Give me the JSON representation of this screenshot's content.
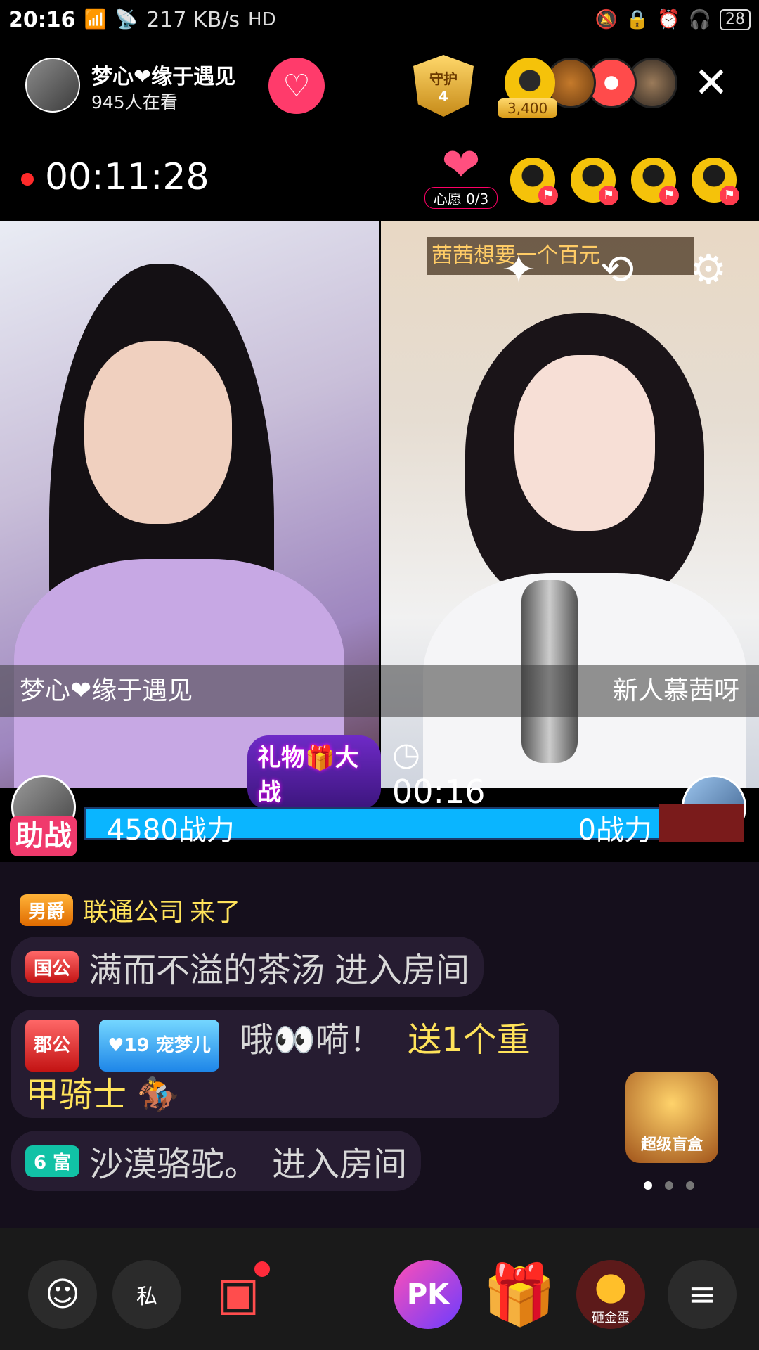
{
  "status": {
    "time": "20:16",
    "net_type": "4G",
    "speed": "217 KB/s",
    "hd": "HD",
    "battery": "28"
  },
  "header": {
    "host_name": "梦心❤缘于遇见",
    "viewers": "945人在看",
    "follow_icon": "heart-plus",
    "guard_label": "守护",
    "guard_count": "4",
    "fan_score": "3,400",
    "close_symbol": "✕"
  },
  "timer": {
    "elapsed": "00:11:28",
    "wish_label": "心愿 0/3"
  },
  "video": {
    "left_name": "梦心❤缘于遇见",
    "right_name": "新人慕茜呀",
    "gift_wish": "茜茜想要一个百元"
  },
  "battle": {
    "title": "礼物🎁大战",
    "countdown": "00:16",
    "left_power": "4580战力",
    "right_power": "0战力",
    "assist_label": "助战"
  },
  "chat": {
    "messages": [
      {
        "badge": "男爵",
        "user": "联通公司",
        "action": "来了"
      },
      {
        "badge": "国公",
        "user": "满而不溢的茶汤",
        "action": "进入房间"
      },
      {
        "badge": "郡公",
        "pet_badge": "宠梦儿",
        "pet_level": "19",
        "user": "哦👀嗬！",
        "gift": "送1个重甲骑士"
      },
      {
        "badge": "6 富",
        "user": "沙漠骆驼。",
        "action": "进入房间"
      }
    ],
    "mystery_box_label": "超级盲盒"
  },
  "bottom": {
    "chat_icon": "chat-icon",
    "private_label": "私",
    "pk_label": "PK",
    "egg_label": "砸金蛋"
  },
  "colors": {
    "accent": "#ff3b6b",
    "battle_blue": "#0ab5ff",
    "gold": "#f5c20a"
  }
}
